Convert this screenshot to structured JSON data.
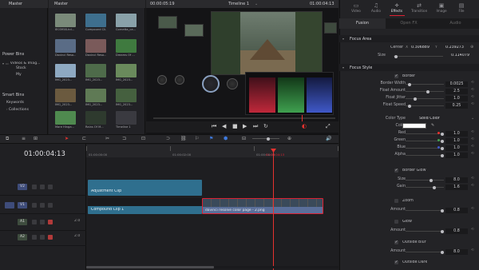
{
  "media_pool": {
    "master_label": "Master",
    "master_bin": "Master",
    "power_bins_label": "Power Bins",
    "power_bins": [
      "Videos & Imag...",
      "Stock",
      "My"
    ],
    "smart_bins_label": "Smart Bins",
    "smart_bins": [
      "Keywords",
      "Collections"
    ],
    "clips": [
      {
        "label": "IE03958-hd...",
        "color": "#7a8a7a"
      },
      {
        "label": "Compound Cli...",
        "color": "#3e6f8e"
      },
      {
        "label": "Cornetta_ca...",
        "color": "#89a1a9"
      },
      {
        "label": "Davinci Reso...",
        "color": "#5a6c86"
      },
      {
        "label": "Davinci Reso...",
        "color": "#7a5a5a"
      },
      {
        "label": "Dreams Of ...",
        "color": "#3f7a3f"
      },
      {
        "label": "IMG_2023...",
        "color": "#8ea9c2"
      },
      {
        "label": "IMG_2023...",
        "color": "#4e6b4a"
      },
      {
        "label": "IMG_2023...",
        "color": "#6a8a5c"
      },
      {
        "label": "IMG_2023...",
        "color": "#6b5a3f"
      },
      {
        "label": "IMG_2023...",
        "color": "#5f7a55"
      },
      {
        "label": "IMG_2023...",
        "color": "#45603f"
      },
      {
        "label": "Mare Hinga...",
        "color": "#4f8a4f"
      },
      {
        "label": "Rains Of M...",
        "color": "#2e3a2e"
      },
      {
        "label": "Timeline 1",
        "color": "#3a3a40"
      }
    ]
  },
  "viewer": {
    "timecode_left": "00:00:05:19",
    "title": "Timeline 1",
    "timecode_right": "01:00:04:13",
    "playhead_timecode": "01:00:04:13"
  },
  "inspector": {
    "tabs": [
      "Video",
      "Audio",
      "Effects",
      "Transition",
      "Image",
      "File"
    ],
    "active_tab": "Effects",
    "subtabs": [
      "Fusion",
      "Open FX",
      "Audio"
    ],
    "focus_area": {
      "title": "Focus Area",
      "center_label": "Center",
      "center_x_label": "X",
      "center_x": "0.306889",
      "center_y_label": "Y",
      "center_y": "0.239273",
      "size_label": "Size",
      "size": "0.114079"
    },
    "focus_style": {
      "title": "Focus Style",
      "border_label": "Border",
      "border_width_label": "Border Width",
      "border_width": "0.0025",
      "float_amount_label": "Float Amount",
      "float_amount": "2.5",
      "float_jitter_label": "Float Jitter",
      "float_jitter": "1.0",
      "float_speed_label": "Float Speed",
      "float_speed": "0.25",
      "color_type_label": "Color Type",
      "color_type": "Solid Color",
      "color_label": "Color",
      "swatch": "#ffffff",
      "red_label": "Red",
      "red": "1.0",
      "green_label": "Green",
      "green": "1.0",
      "blue_label": "Blue",
      "blue": "1.0",
      "alpha_label": "Alpha",
      "alpha": "1.0",
      "border_glow_label": "Border Glow",
      "size_label": "Size",
      "size": "8.0",
      "gain_label": "Gain",
      "gain": "1.6",
      "zoom_label": "Zoom",
      "zoom_amount_label": "Amount",
      "zoom_amount": "0.8",
      "glow_label": "Glow",
      "glow_amount_label": "Amount",
      "glow_amount": "0.8",
      "outside_blur_label": "Outside Blur",
      "outside_blur_amount_label": "Amount",
      "outside_blur_amount": "8.0",
      "outside_dark_label": "Outside Dark"
    }
  },
  "timeline": {
    "timecode": "01:00:04:13",
    "ruler_ticks": [
      "01:00:00:00",
      "01:00:02:00",
      "01:00:04:00"
    ],
    "tracks": [
      {
        "id": "V2",
        "type": "video"
      },
      {
        "id": "V1",
        "type": "video"
      },
      {
        "id": "A1",
        "type": "audio",
        "value": "2.0"
      },
      {
        "id": "A2",
        "type": "audio",
        "value": "2.0"
      }
    ],
    "clips": {
      "adjustment": "Adjustment Clip",
      "compound": "Compound Clip 1",
      "davinci": "davinci resolve color page - 2.png"
    },
    "colors": {
      "adjustment": "#2f6f8e",
      "compound": "#2f6f8e",
      "davinci": "#5a6f9a",
      "playhead": "#e5322f"
    }
  }
}
